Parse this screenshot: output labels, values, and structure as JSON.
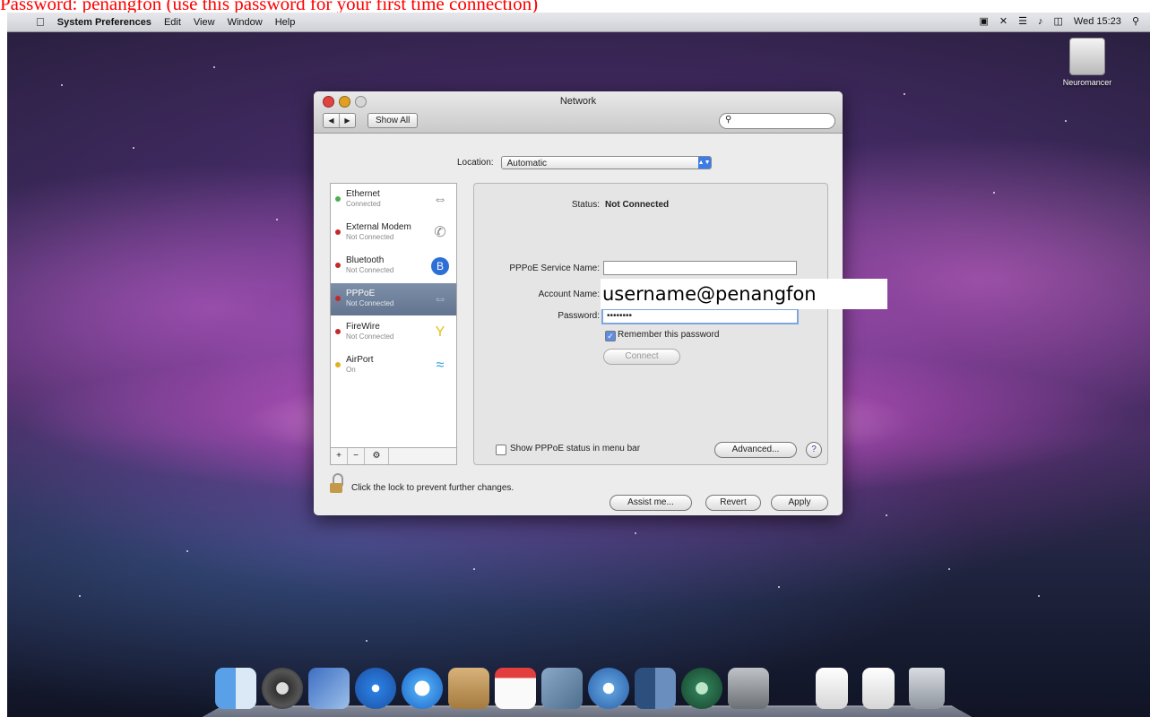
{
  "caption": "Password: penangfon (use this password for your first time connection)",
  "menubar": {
    "apple": "",
    "app": "System Preferences",
    "items": [
      "Edit",
      "View",
      "Window",
      "Help"
    ],
    "clock": "Wed 15:23",
    "status_icons": [
      "input-menu-icon",
      "bluetooth-icon",
      "wifi-icon",
      "volume-icon",
      "battery-icon",
      "spotlight-icon"
    ]
  },
  "desktop": {
    "hd_label": "Neuromancer"
  },
  "window": {
    "title": "Network",
    "show_all": "Show All",
    "search_placeholder": "",
    "location_label": "Location:",
    "location_value": "Automatic",
    "services": [
      {
        "name": "Ethernet",
        "status": "Connected",
        "dot": "#4caf50",
        "icon": "ethernet-icon"
      },
      {
        "name": "External Modem",
        "status": "Not Connected",
        "dot": "#c62828",
        "icon": "modem-phone-icon"
      },
      {
        "name": "Bluetooth",
        "status": "Not Connected",
        "dot": "#c62828",
        "icon": "bluetooth-icon"
      },
      {
        "name": "PPPoE",
        "status": "Not Connected",
        "dot": "#c62828",
        "icon": "pppoe-icon"
      },
      {
        "name": "FireWire",
        "status": "Not Connected",
        "dot": "#c62828",
        "icon": "firewire-icon"
      },
      {
        "name": "AirPort",
        "status": "On",
        "dot": "#e0b020",
        "icon": "airport-wifi-icon"
      }
    ],
    "selected_service": "PPPoE",
    "detail": {
      "status_label": "Status:",
      "status_value": "Not Connected",
      "service_name_label": "PPPoE Service Name:",
      "service_name_value": "",
      "account_label": "Account Name:",
      "password_label": "Password:",
      "password_value": "••••••••",
      "remember_label": "Remember this password",
      "connect_label": "Connect",
      "show_status_label": "Show PPPoE status in menu bar",
      "advanced_label": "Advanced...",
      "help_label": "?"
    },
    "lock_text": "Click the lock to prevent further changes.",
    "assist_label": "Assist me...",
    "revert_label": "Revert",
    "apply_label": "Apply"
  },
  "overlay_account": "username@penangfon",
  "colors": {
    "caption": "#ff0000",
    "selected_row": "#6f81a0",
    "accent": "#3c7be8"
  }
}
